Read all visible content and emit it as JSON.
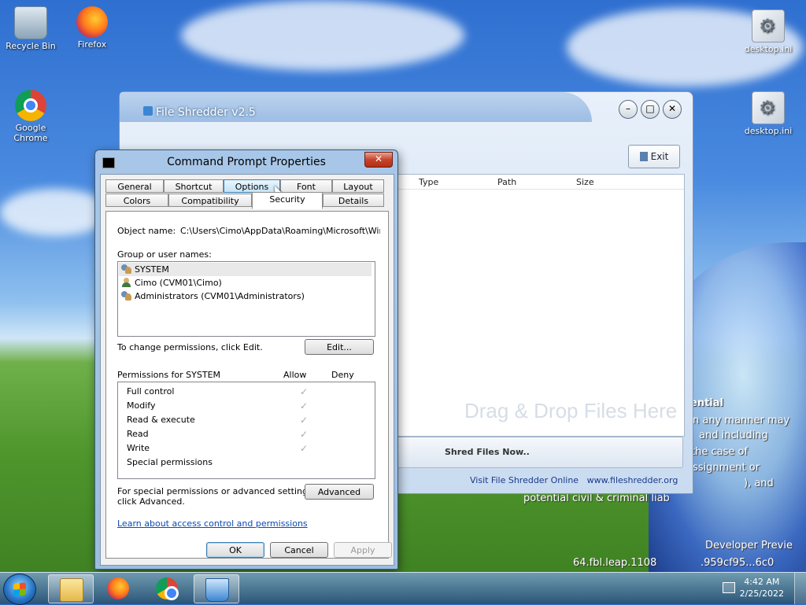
{
  "desktop": {
    "icons": [
      {
        "label": "Recycle Bin",
        "icon": "recycle-bin-icon"
      },
      {
        "label": "Firefox",
        "icon": "firefox-icon"
      },
      {
        "label": "Google Chrome",
        "icon": "chrome-icon"
      },
      {
        "label": "desktop.ini",
        "icon": "settings-file-icon"
      },
      {
        "label": "desktop.ini",
        "icon": "settings-file-icon"
      }
    ],
    "wallpaper_text": {
      "l1": "ential",
      "l2": "n any manner may",
      "l3": "and including",
      "l4": "the case of",
      "l5": "ssignment or",
      "l6": "), and",
      "l7": "potential civil & criminal liab",
      "l8": "Developer Previe",
      "l9": "64.fbl.leap.1108",
      "l10": ".959cf95...6c0"
    }
  },
  "file_shredder": {
    "title": "File Shredder v2.5",
    "exit_label": "Exit",
    "columns": [
      "Type",
      "Path",
      "Size"
    ],
    "drag_hint": "Drag & Drop Files Here",
    "shred_label": "Shred Files Now..",
    "footer_link": "Visit File Shredder Online",
    "footer_url": "www.fileshredder.org"
  },
  "dialog": {
    "title": "Command Prompt Properties",
    "tabs_row1": [
      "General",
      "Shortcut",
      "Options",
      "Font",
      "Layout"
    ],
    "tabs_row2": [
      "Colors",
      "Compatibility",
      "Security",
      "Details"
    ],
    "active_tab": "Security",
    "object_name_label": "Object name:",
    "object_name_value": "C:\\Users\\Cimo\\AppData\\Roaming\\Microsoft\\Windo",
    "group_label": "Group or user names:",
    "users": [
      {
        "name": "SYSTEM",
        "icon": "group-icon"
      },
      {
        "name": "Cimo (CVM01\\Cimo)",
        "icon": "user-icon"
      },
      {
        "name": "Administrators (CVM01\\Administrators)",
        "icon": "group-icon"
      }
    ],
    "change_text": "To change permissions, click Edit.",
    "edit_button": "Edit...",
    "perm_header": "Permissions for SYSTEM",
    "allow_header": "Allow",
    "deny_header": "Deny",
    "permissions": [
      {
        "name": "Full control",
        "allow": true,
        "deny": false
      },
      {
        "name": "Modify",
        "allow": true,
        "deny": false
      },
      {
        "name": "Read & execute",
        "allow": true,
        "deny": false
      },
      {
        "name": "Read",
        "allow": true,
        "deny": false
      },
      {
        "name": "Write",
        "allow": true,
        "deny": false
      },
      {
        "name": "Special permissions",
        "allow": false,
        "deny": false
      }
    ],
    "advanced_text_1": "For special permissions or advanced settings,",
    "advanced_text_2": "click Advanced.",
    "advanced_button": "Advanced",
    "learn_link": "Learn about access control and permissions",
    "ok_button": "OK",
    "cancel_button": "Cancel",
    "apply_button": "Apply",
    "close_glyph": "✕",
    "check_glyph": "✓"
  },
  "taskbar": {
    "time": "4:42 AM",
    "date": "2/25/2022"
  }
}
